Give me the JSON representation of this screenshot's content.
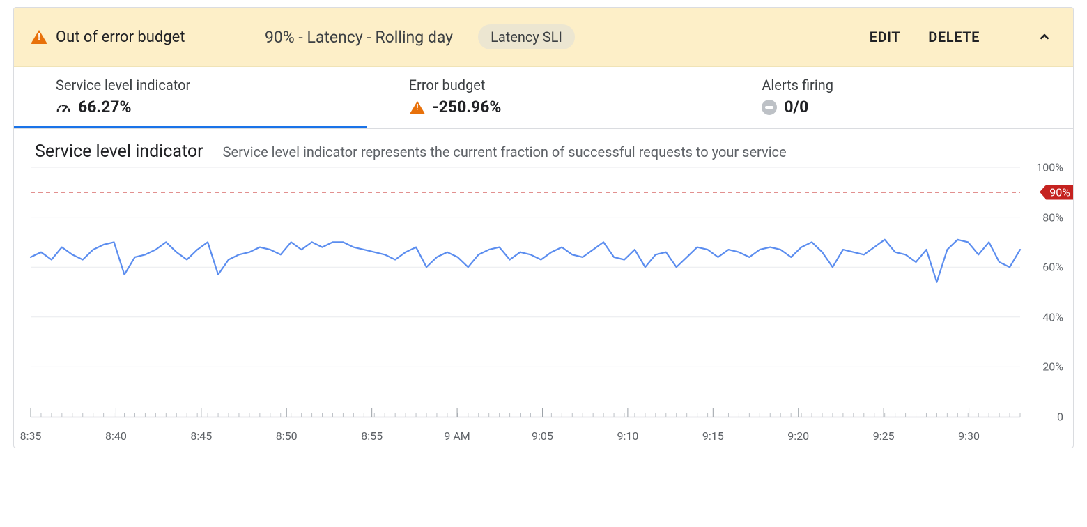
{
  "banner": {
    "status_text": "Out of error budget",
    "title": "90% - Latency - Rolling day",
    "chip": "Latency SLI",
    "edit_label": "EDIT",
    "delete_label": "DELETE"
  },
  "metrics": {
    "sli": {
      "label": "Service level indicator",
      "value": "66.27%"
    },
    "budget": {
      "label": "Error budget",
      "value": "-250.96%"
    },
    "alerts": {
      "label": "Alerts firing",
      "value": "0/0"
    }
  },
  "section": {
    "title": "Service level indicator",
    "subtitle": "Service level indicator represents the current fraction of successful requests to your service"
  },
  "chart_data": {
    "type": "line",
    "ylabel": "",
    "xlabel": "",
    "ylim": [
      0,
      100
    ],
    "y_ticks": [
      0,
      20,
      40,
      60,
      80,
      100
    ],
    "y_tick_labels": [
      "0",
      "20%",
      "40%",
      "60%",
      "80%",
      "100%"
    ],
    "threshold": {
      "value": 90,
      "label": "90%"
    },
    "x_tick_labels": [
      "8:35",
      "8:40",
      "8:45",
      "8:50",
      "8:55",
      "9 AM",
      "9:05",
      "9:10",
      "9:15",
      "9:20",
      "9:25",
      "9:30"
    ],
    "series": [
      {
        "name": "SLI",
        "color": "#5b8def",
        "values": [
          64,
          66,
          63,
          68,
          65,
          63,
          67,
          69,
          70,
          57,
          64,
          65,
          67,
          70,
          66,
          63,
          67,
          70,
          57,
          63,
          65,
          66,
          68,
          67,
          65,
          70,
          67,
          70,
          68,
          70,
          70,
          68,
          67,
          66,
          65,
          63,
          66,
          68,
          60,
          64,
          66,
          64,
          60,
          65,
          67,
          68,
          63,
          66,
          65,
          63,
          66,
          68,
          65,
          64,
          67,
          70,
          64,
          63,
          67,
          60,
          65,
          66,
          60,
          64,
          68,
          67,
          64,
          67,
          66,
          64,
          67,
          68,
          67,
          64,
          68,
          70,
          66,
          60,
          67,
          66,
          65,
          68,
          71,
          66,
          65,
          62,
          67,
          54,
          67,
          71,
          70,
          65,
          70,
          62,
          60,
          67
        ]
      }
    ]
  }
}
